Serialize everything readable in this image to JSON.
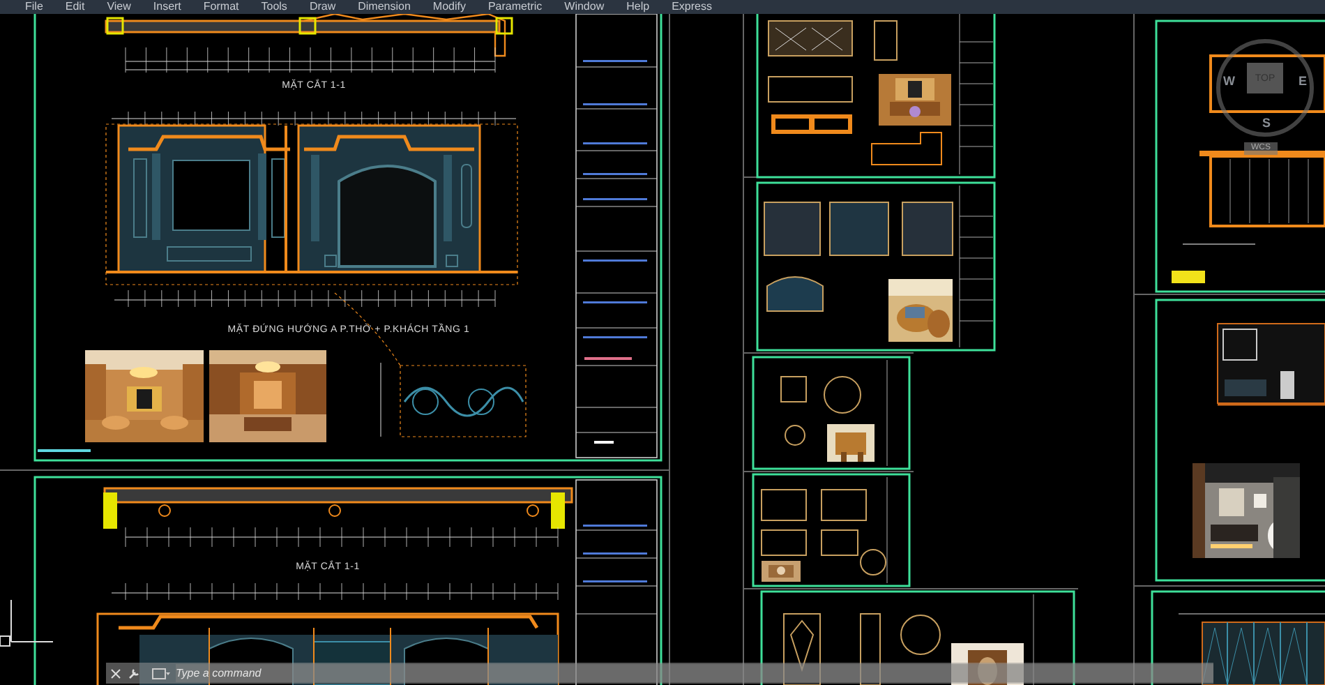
{
  "menu": [
    {
      "label": "File"
    },
    {
      "label": "Edit"
    },
    {
      "label": "View"
    },
    {
      "label": "Insert"
    },
    {
      "label": "Format"
    },
    {
      "label": "Tools"
    },
    {
      "label": "Draw"
    },
    {
      "label": "Dimension"
    },
    {
      "label": "Modify"
    },
    {
      "label": "Parametric"
    },
    {
      "label": "Window"
    },
    {
      "label": "Help"
    },
    {
      "label": "Express"
    }
  ],
  "sheets": [
    {
      "section_title": "MẶT CẮT 1-1",
      "elevation_title": "MẶT ĐỨNG HƯỚNG A P.THỜ + P.KHÁCH TẦNG 1"
    },
    {
      "section_title": "MẶT CẮT 1-1"
    }
  ],
  "viewcube": {
    "west": "W",
    "face": "TOP",
    "east": "E",
    "south": "S",
    "ucs": "WCS"
  },
  "command": {
    "placeholder": "Type a command"
  }
}
